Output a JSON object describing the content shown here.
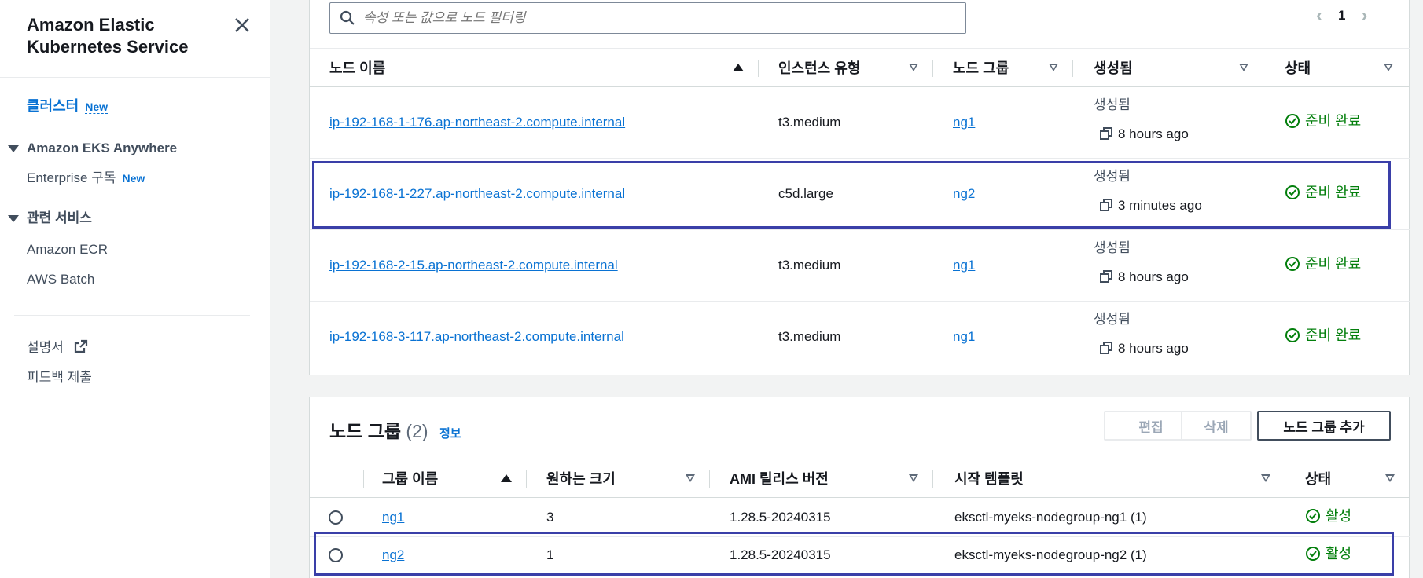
{
  "sidebar": {
    "title_line1": "Amazon Elastic",
    "title_line2": "Kubernetes Service",
    "clusters": "클러스터",
    "new_badge": "New",
    "eks_anywhere": "Amazon EKS Anywhere",
    "enterprise": "Enterprise 구독",
    "related_services": "관련 서비스",
    "ecr": "Amazon ECR",
    "batch": "AWS Batch",
    "docs": "설명서",
    "feedback": "피드백 제출"
  },
  "nodes": {
    "search_placeholder": "속성 또는 값으로 노드 필터링",
    "page": "1",
    "headers": {
      "name": "노드 이름",
      "instance_type": "인스턴스 유형",
      "node_group": "노드 그룹",
      "created": "생성됨",
      "status": "상태"
    },
    "rows": [
      {
        "name": "ip-192-168-1-176.ap-northeast-2.compute.internal",
        "instance": "t3.medium",
        "group": "ng1",
        "created_label": "생성됨",
        "created": "8 hours ago",
        "status": "준비 완료"
      },
      {
        "name": "ip-192-168-1-227.ap-northeast-2.compute.internal",
        "instance": "c5d.large",
        "group": "ng2",
        "created_label": "생성됨",
        "created": "3 minutes ago",
        "status": "준비 완료"
      },
      {
        "name": "ip-192-168-2-15.ap-northeast-2.compute.internal",
        "instance": "t3.medium",
        "group": "ng1",
        "created_label": "생성됨",
        "created": "8 hours ago",
        "status": "준비 완료"
      },
      {
        "name": "ip-192-168-3-117.ap-northeast-2.compute.internal",
        "instance": "t3.medium",
        "group": "ng1",
        "created_label": "생성됨",
        "created": "8 hours ago",
        "status": "준비 완료"
      }
    ]
  },
  "nodegroups": {
    "title": "노드 그룹",
    "count": "(2)",
    "info": "정보",
    "edit_button": "편집",
    "delete_button": "삭제",
    "add_button": "노드 그룹 추가",
    "headers": {
      "name": "그룹 이름",
      "desired": "원하는 크기",
      "ami": "AMI 릴리스 버전",
      "template": "시작 템플릿",
      "status": "상태"
    },
    "rows": [
      {
        "name": "ng1",
        "desired": "3",
        "ami": "1.28.5-20240315",
        "template": "eksctl-myeks-nodegroup-ng1 (1)",
        "status": "활성"
      },
      {
        "name": "ng2",
        "desired": "1",
        "ami": "1.28.5-20240315",
        "template": "eksctl-myeks-nodegroup-ng2 (1)",
        "status": "활성"
      }
    ]
  },
  "colors": {
    "link": "#0972d3",
    "success": "#037f0c",
    "highlight": "#3a3fa8"
  }
}
